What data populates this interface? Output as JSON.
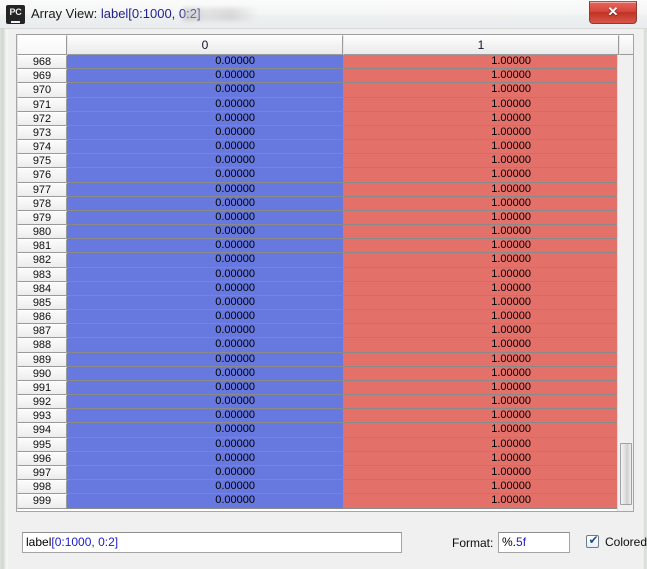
{
  "window": {
    "app_icon": "pycharm-icon",
    "title_prefix": "Array View: ",
    "title_expression": "label[0:1000, 0:2]",
    "close_label": "✕"
  },
  "table": {
    "corner_header": "",
    "column_headers": [
      "0",
      "1"
    ],
    "row_labels": [
      "968",
      "969",
      "970",
      "971",
      "972",
      "973",
      "974",
      "975",
      "976",
      "977",
      "978",
      "979",
      "980",
      "981",
      "982",
      "983",
      "984",
      "985",
      "986",
      "987",
      "988",
      "989",
      "990",
      "991",
      "992",
      "993",
      "994",
      "995",
      "996",
      "997",
      "998",
      "999"
    ],
    "cells": [
      [
        "0.00000",
        "1.00000"
      ],
      [
        "0.00000",
        "1.00000"
      ],
      [
        "0.00000",
        "1.00000"
      ],
      [
        "0.00000",
        "1.00000"
      ],
      [
        "0.00000",
        "1.00000"
      ],
      [
        "0.00000",
        "1.00000"
      ],
      [
        "0.00000",
        "1.00000"
      ],
      [
        "0.00000",
        "1.00000"
      ],
      [
        "0.00000",
        "1.00000"
      ],
      [
        "0.00000",
        "1.00000"
      ],
      [
        "0.00000",
        "1.00000"
      ],
      [
        "0.00000",
        "1.00000"
      ],
      [
        "0.00000",
        "1.00000"
      ],
      [
        "0.00000",
        "1.00000"
      ],
      [
        "0.00000",
        "1.00000"
      ],
      [
        "0.00000",
        "1.00000"
      ],
      [
        "0.00000",
        "1.00000"
      ],
      [
        "0.00000",
        "1.00000"
      ],
      [
        "0.00000",
        "1.00000"
      ],
      [
        "0.00000",
        "1.00000"
      ],
      [
        "0.00000",
        "1.00000"
      ],
      [
        "0.00000",
        "1.00000"
      ],
      [
        "0.00000",
        "1.00000"
      ],
      [
        "0.00000",
        "1.00000"
      ],
      [
        "0.00000",
        "1.00000"
      ],
      [
        "0.00000",
        "1.00000"
      ],
      [
        "0.00000",
        "1.00000"
      ],
      [
        "0.00000",
        "1.00000"
      ],
      [
        "0.00000",
        "1.00000"
      ],
      [
        "0.00000",
        "1.00000"
      ],
      [
        "0.00000",
        "1.00000"
      ],
      [
        "0.00000",
        "1.00000"
      ]
    ],
    "column_colors": [
      "#6778df",
      "#e4706a"
    ],
    "scrollbar": "vertical-scrollbar"
  },
  "bottom": {
    "expression_prefix": "label",
    "expression_suffix": "[0:1000, 0:2]",
    "format_label": "Format:",
    "format_prefix": "%.",
    "format_suffix": "5f",
    "colored_label": "Colored",
    "colored_checked": "✔"
  }
}
